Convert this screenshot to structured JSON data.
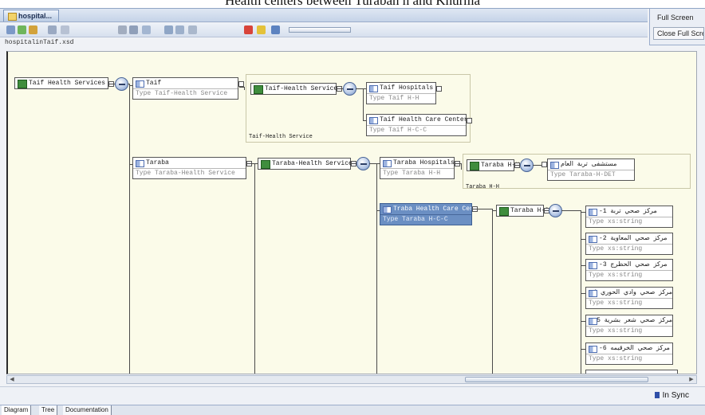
{
  "caption": "Health centers between Turaban h and Khurma",
  "window": {
    "doc_tab": "hospital..."
  },
  "side_panel": {
    "full_screen": "Full Screen",
    "close_full_screen": "Close Full Screen"
  },
  "toolbar": {
    "icons": [
      "new-file-icon",
      "validate-icon",
      "check-icon",
      "xpath-icon",
      "function-icon",
      "cut-icon",
      "copy-icon",
      "paste-icon",
      "find-icon",
      "replace-icon",
      "format-icon",
      "stop-icon",
      "play-icon",
      "save-icon",
      "progress-bar"
    ]
  },
  "file_path": "hospitalinTaif.xsd",
  "diagram": {
    "root": {
      "label": "Taif Health Services"
    },
    "taif": {
      "name": "Taif",
      "type_label": "Type",
      "type_value": "Taif-Health Service",
      "ctype": "Taif-Health Service",
      "group_label": "Taif-Health Service",
      "children": [
        {
          "name": "Taif Hospitals",
          "type_label": "Type",
          "type_value": "Taif H-H"
        },
        {
          "name": "Taif Health Care Centers",
          "type_label": "Type",
          "type_value": "Taif H-C-C"
        }
      ]
    },
    "taraba": {
      "name": "Taraba",
      "type_label": "Type",
      "type_value": "Taraba-Health Service",
      "ctype": "Taraba-Health Service",
      "hospitals": {
        "name": "Taraba Hospitals",
        "type_label": "Type",
        "type_value": "Taraba H-H"
      },
      "hh_ctype": "Taraba H-H",
      "hh_group_label": "Taraba H-H",
      "general_hospital": {
        "name": "مستشفى تربة العام",
        "type_label": "Type",
        "type_value": "Taraba-H-DET"
      },
      "care_centers": {
        "name": "Traba Health Care Centers",
        "type_label": "Type",
        "type_value": "Taraba H-C-C"
      },
      "hcc_ctype": "Taraba H-C-C",
      "centers": [
        {
          "name": "مركز صحي تربة  1-",
          "type_label": "Type",
          "type_value": "xs:string"
        },
        {
          "name": "مركز صحي المعاوية  2-",
          "type_label": "Type",
          "type_value": "xs:string"
        },
        {
          "name": "مركز صحي الحظرج  3-",
          "type_label": "Type",
          "type_value": "xs:string"
        },
        {
          "name": "مركز صحي وادي الحوري  4-",
          "type_label": "Type",
          "type_value": "xs:string"
        },
        {
          "name": "مركز صحي شعر بشرية  5-",
          "type_label": "Type",
          "type_value": "xs:string"
        },
        {
          "name": "مركز صحي الخرقيمه  6-",
          "type_label": "Type",
          "type_value": "xs:string"
        }
      ]
    }
  },
  "status": {
    "sync": "In Sync"
  },
  "tabs": [
    "Diagram",
    "Tree",
    "Documentation"
  ],
  "colors": {
    "selection": "#6b8fc3",
    "canvas": "#fbfbe9",
    "complex_type": "#3f8d3d"
  }
}
